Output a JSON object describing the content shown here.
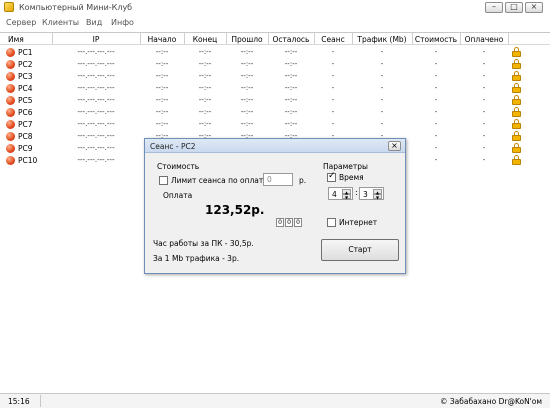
{
  "window": {
    "title": "Компьютерный Мини-Клуб"
  },
  "menu": [
    "Сервер",
    "Клиенты",
    "Вид",
    "Инфо"
  ],
  "columns": [
    "Имя",
    "IP",
    "Начало",
    "Конец",
    "Прошло",
    "Осталось",
    "Сеанс",
    "Трафик (Mb)",
    "Стоимость",
    "Оплачено"
  ],
  "rows": [
    {
      "name": "PC1",
      "ip": "---.---.---.---",
      "start": "--:--",
      "end": "--:--",
      "elapsed": "--:--",
      "remaining": "--:--",
      "session": "-",
      "traffic": "-",
      "cost": "-",
      "paid": "-"
    },
    {
      "name": "PC2",
      "ip": "---.---.---.---",
      "start": "--:--",
      "end": "--:--",
      "elapsed": "--:--",
      "remaining": "--:--",
      "session": "-",
      "traffic": "-",
      "cost": "-",
      "paid": "-"
    },
    {
      "name": "PC3",
      "ip": "---.---.---.---",
      "start": "--:--",
      "end": "--:--",
      "elapsed": "--:--",
      "remaining": "--:--",
      "session": "-",
      "traffic": "-",
      "cost": "-",
      "paid": "-"
    },
    {
      "name": "PC4",
      "ip": "---.---.---.---",
      "start": "--:--",
      "end": "--:--",
      "elapsed": "--:--",
      "remaining": "--:--",
      "session": "-",
      "traffic": "-",
      "cost": "-",
      "paid": "-"
    },
    {
      "name": "PC5",
      "ip": "---.---.---.---",
      "start": "--:--",
      "end": "--:--",
      "elapsed": "--:--",
      "remaining": "--:--",
      "session": "-",
      "traffic": "-",
      "cost": "-",
      "paid": "-"
    },
    {
      "name": "PC6",
      "ip": "---.---.---.---",
      "start": "--:--",
      "end": "--:--",
      "elapsed": "--:--",
      "remaining": "--:--",
      "session": "-",
      "traffic": "-",
      "cost": "-",
      "paid": "-"
    },
    {
      "name": "PC7",
      "ip": "---.---.---.---",
      "start": "--:--",
      "end": "--:--",
      "elapsed": "--:--",
      "remaining": "--:--",
      "session": "-",
      "traffic": "-",
      "cost": "-",
      "paid": "-"
    },
    {
      "name": "PC8",
      "ip": "---.---.---.---",
      "start": "--:--",
      "end": "--:--",
      "elapsed": "--:--",
      "remaining": "--:--",
      "session": "-",
      "traffic": "-",
      "cost": "-",
      "paid": "-"
    },
    {
      "name": "PC9",
      "ip": "---.---.---.---",
      "start": "--:--",
      "end": "--:--",
      "elapsed": "--:--",
      "remaining": "--:--",
      "session": "-",
      "traffic": "-",
      "cost": "-",
      "paid": "-"
    },
    {
      "name": "PC10",
      "ip": "---.---.---.---",
      "start": "--:--",
      "end": "--:--",
      "elapsed": "--:--",
      "remaining": "--:--",
      "session": "-",
      "traffic": "-",
      "cost": "-",
      "paid": "-"
    }
  ],
  "dialog": {
    "title": "Сеанс - PC2",
    "cost_group": "Стоимость",
    "limit_label": "Лимит сеанса по оплате:",
    "limit_value": "0",
    "limit_unit": "р.",
    "payment_label": "Оплата",
    "amount": "123,52р.",
    "mini_buttons": [
      "0",
      "0",
      "0"
    ],
    "params_group": "Параметры",
    "time_label": "Время",
    "hours": "4",
    "minutes": "3",
    "internet_label": "Интернет",
    "rate_pc": "Час работы за ПК - 30,5р.",
    "rate_traffic": "За 1 Mb трафика - 3р.",
    "start_button": "Старт"
  },
  "status": {
    "time": "15:16",
    "credit": "© Забабахано Dr@KoN'ом"
  },
  "icons": {
    "pc": "pc-status-icon",
    "lock": "lock-icon"
  },
  "colors": {
    "pc_icon": "#e24a1e",
    "lock": "#f3b400",
    "dialog_border": "#6f8fb8"
  }
}
